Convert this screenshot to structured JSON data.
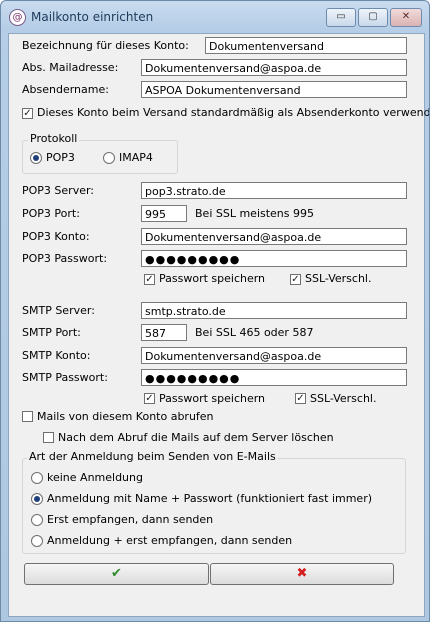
{
  "window": {
    "title": "Mailkonto einrichten",
    "min_glyph": "▭",
    "max_glyph": "▢",
    "close_glyph": "✕",
    "app_glyph": "@"
  },
  "account": {
    "name_label": "Bezeichnung für dieses Konto:",
    "name_value": "Dokumentenversand",
    "address_label": "Abs. Mailadresse:",
    "address_value": "Dokumentenversand@aspoa.de",
    "sender_label": "Absendername:",
    "sender_value": "ASPOA Dokumentenversand",
    "default_checked": true,
    "default_label": "Dieses Konto beim Versand standardmäßig als Absenderkonto verwenden"
  },
  "protocol": {
    "title": "Protokoll",
    "options": [
      {
        "label": "POP3",
        "selected": true
      },
      {
        "label": "IMAP4",
        "selected": false
      }
    ]
  },
  "pop3": {
    "server_label": "POP3 Server:",
    "server_value": "pop3.strato.de",
    "port_label": "POP3 Port:",
    "port_value": "995",
    "port_hint": "Bei SSL meistens 995",
    "account_label": "POP3 Konto:",
    "account_value": "Dokumentenversand@aspoa.de",
    "password_label": "POP3 Passwort:",
    "password_value": "●●●●●●●●●",
    "save_password_label": "Passwort speichern",
    "save_password_checked": true,
    "ssl_label": "SSL-Verschl.",
    "ssl_checked": true
  },
  "smtp": {
    "server_label": "SMTP Server:",
    "server_value": "smtp.strato.de",
    "port_label": "SMTP Port:",
    "port_value": "587",
    "port_hint": "Bei SSL 465 oder 587",
    "account_label": "SMTP Konto:",
    "account_value": "Dokumentenversand@aspoa.de",
    "password_label": "SMTP Passwort:",
    "password_value": "●●●●●●●●●",
    "save_password_label": "Passwort speichern",
    "save_password_checked": true,
    "ssl_label": "SSL-Verschl.",
    "ssl_checked": true
  },
  "fetch": {
    "fetch_label": "Mails von diesem Konto abrufen",
    "fetch_checked": false,
    "delete_label": "Nach dem Abruf die Mails auf dem Server löschen",
    "delete_checked": false
  },
  "auth": {
    "title": "Art der Anmeldung beim Senden von E-Mails",
    "options": [
      {
        "label": "keine Anmeldung",
        "selected": false
      },
      {
        "label": "Anmeldung mit Name + Passwort (funktioniert fast immer)",
        "selected": true
      },
      {
        "label": "Erst empfangen, dann senden",
        "selected": false
      },
      {
        "label": "Anmeldung + erst empfangen, dann senden",
        "selected": false
      }
    ]
  },
  "buttons": {
    "ok_glyph": "✔",
    "ok_color": "#2e8b2e",
    "cancel_glyph": "✖",
    "cancel_color": "#d42020"
  }
}
